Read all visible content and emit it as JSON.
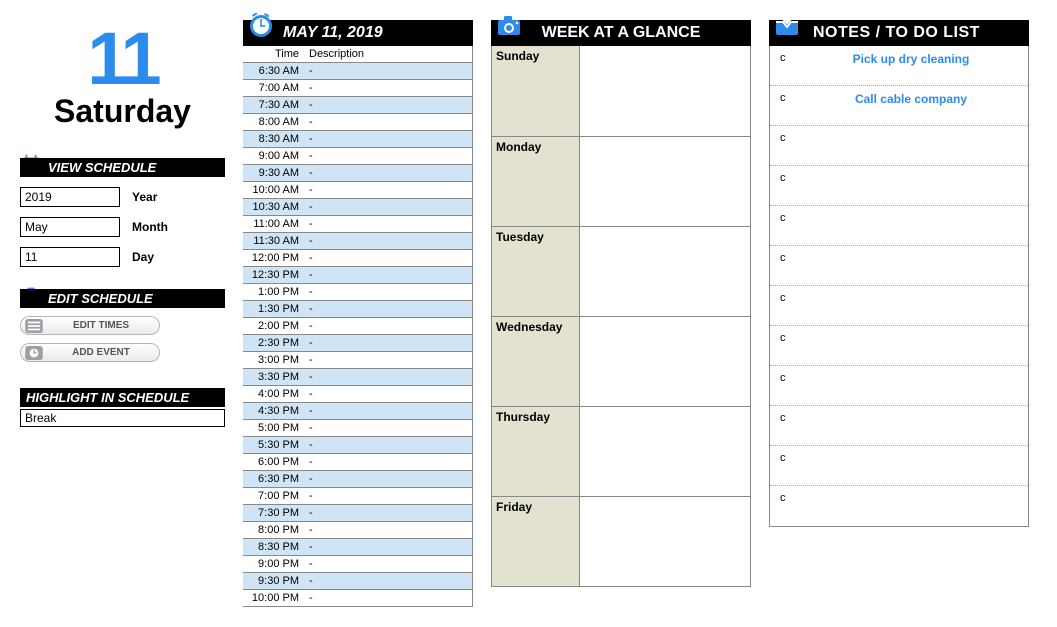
{
  "big_date": {
    "number": "11",
    "weekday": "Saturday"
  },
  "sidebar": {
    "view_label": "VIEW SCHEDULE",
    "year": {
      "value": "2019",
      "label": "Year"
    },
    "month": {
      "value": "May",
      "label": "Month"
    },
    "day": {
      "value": "11",
      "label": "Day"
    },
    "edit_label": "EDIT SCHEDULE",
    "btn_edit_times": "EDIT TIMES",
    "btn_add_event": "ADD  EVENT",
    "highlight_label": "HIGHLIGHT IN SCHEDULE",
    "highlight_value": "Break"
  },
  "schedule": {
    "title": "MAY 11,  2019",
    "col_time": "Time",
    "col_desc": "Description",
    "rows": [
      {
        "time": "6:30 AM",
        "desc": "-"
      },
      {
        "time": "7:00 AM",
        "desc": "-"
      },
      {
        "time": "7:30 AM",
        "desc": "-"
      },
      {
        "time": "8:00 AM",
        "desc": "-"
      },
      {
        "time": "8:30 AM",
        "desc": "-"
      },
      {
        "time": "9:00 AM",
        "desc": "-"
      },
      {
        "time": "9:30 AM",
        "desc": "-"
      },
      {
        "time": "10:00 AM",
        "desc": "-"
      },
      {
        "time": "10:30 AM",
        "desc": "-"
      },
      {
        "time": "11:00 AM",
        "desc": "-"
      },
      {
        "time": "11:30 AM",
        "desc": "-"
      },
      {
        "time": "12:00 PM",
        "desc": "-"
      },
      {
        "time": "12:30 PM",
        "desc": "-"
      },
      {
        "time": "1:00 PM",
        "desc": "-"
      },
      {
        "time": "1:30 PM",
        "desc": "-"
      },
      {
        "time": "2:00 PM",
        "desc": "-"
      },
      {
        "time": "2:30 PM",
        "desc": "-"
      },
      {
        "time": "3:00 PM",
        "desc": "-"
      },
      {
        "time": "3:30 PM",
        "desc": "-"
      },
      {
        "time": "4:00 PM",
        "desc": "-"
      },
      {
        "time": "4:30 PM",
        "desc": "-"
      },
      {
        "time": "5:00 PM",
        "desc": "-"
      },
      {
        "time": "5:30 PM",
        "desc": "-"
      },
      {
        "time": "6:00 PM",
        "desc": "-"
      },
      {
        "time": "6:30 PM",
        "desc": "-"
      },
      {
        "time": "7:00 PM",
        "desc": "-"
      },
      {
        "time": "7:30 PM",
        "desc": "-"
      },
      {
        "time": "8:00 PM",
        "desc": "-"
      },
      {
        "time": "8:30 PM",
        "desc": "-"
      },
      {
        "time": "9:00 PM",
        "desc": "-"
      },
      {
        "time": "9:30 PM",
        "desc": "-"
      },
      {
        "time": "10:00 PM",
        "desc": "-"
      }
    ]
  },
  "week": {
    "title": "WEEK AT A GLANCE",
    "days": [
      "Sunday",
      "Monday",
      "Tuesday",
      "Wednesday",
      "Thursday",
      "Friday"
    ]
  },
  "todo": {
    "title": "NOTES / TO DO LIST",
    "items": [
      {
        "mark": "c",
        "text": "Pick up dry cleaning"
      },
      {
        "mark": "c",
        "text": "Call cable company"
      },
      {
        "mark": "c",
        "text": ""
      },
      {
        "mark": "c",
        "text": ""
      },
      {
        "mark": "c",
        "text": ""
      },
      {
        "mark": "c",
        "text": ""
      },
      {
        "mark": "c",
        "text": ""
      },
      {
        "mark": "c",
        "text": ""
      },
      {
        "mark": "c",
        "text": ""
      },
      {
        "mark": "c",
        "text": ""
      },
      {
        "mark": "c",
        "text": ""
      },
      {
        "mark": "c",
        "text": ""
      }
    ]
  }
}
